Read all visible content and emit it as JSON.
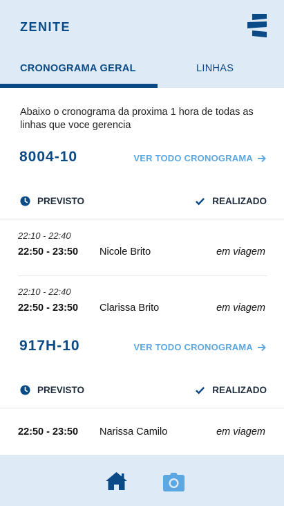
{
  "app": {
    "title": "ZENITE"
  },
  "tabs": [
    {
      "label": "CRONOGRAMA GERAL",
      "active": true
    },
    {
      "label": "LINHAS",
      "active": false
    }
  ],
  "intro": "Abaixo o cronograma da proxima 1 hora de todas as linhas que voce gerencia",
  "lines": [
    {
      "code": "8004-10",
      "link_label": "VER TODO CRONOGRAMA",
      "legend_planned": "PREVISTO",
      "legend_done": "REALIZADO",
      "trips": [
        {
          "planned": "22:10 - 22:40",
          "actual": "22:50 - 23:50",
          "driver": "Nicole Brito",
          "status": "em viagem"
        },
        {
          "planned": "22:10 - 22:40",
          "actual": "22:50 - 23:50",
          "driver": "Clarissa Brito",
          "status": "em viagem"
        }
      ]
    },
    {
      "code": "917H-10",
      "link_label": "VER TODO CRONOGRAMA",
      "legend_planned": "PREVISTO",
      "legend_done": "REALIZADO",
      "trips": [
        {
          "actual": "22:50 - 23:50",
          "driver": "Narissa Camilo",
          "status": "em viagem"
        }
      ]
    }
  ],
  "bottom_nav": [
    {
      "icon": "home-icon",
      "color": "#0a4a86"
    },
    {
      "icon": "camera-icon",
      "color": "#5aa7e3"
    }
  ],
  "colors": {
    "primary": "#0a4a86",
    "accent": "#5aa7e3",
    "header_bg": "#deeaf6"
  }
}
